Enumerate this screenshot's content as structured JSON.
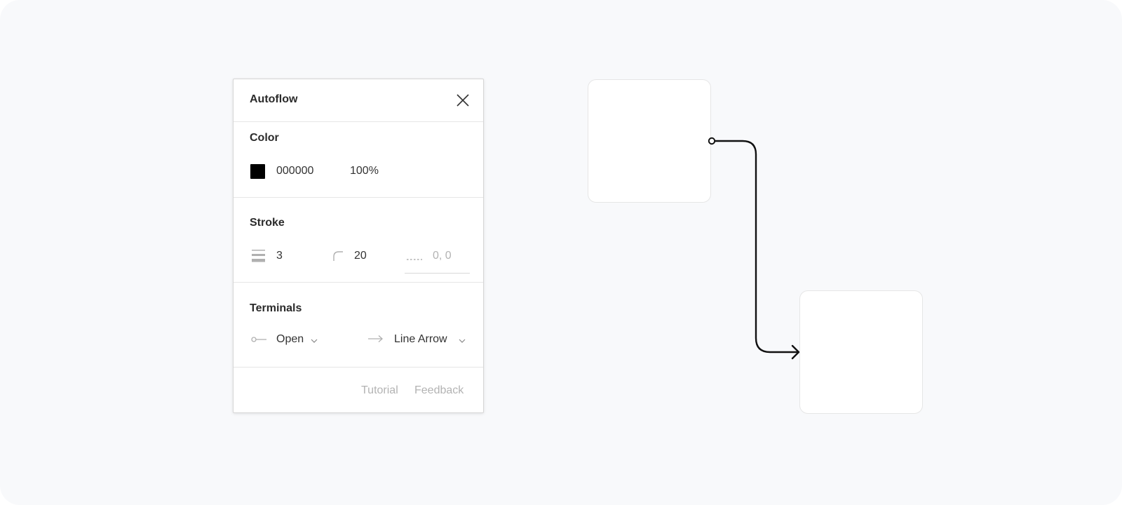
{
  "panel": {
    "title": "Autoflow",
    "color": {
      "heading": "Color",
      "hex": "000000",
      "swatch": "#000000",
      "opacity": "100%"
    },
    "stroke": {
      "heading": "Stroke",
      "weight": "3",
      "corner_radius": "20",
      "dash": "0, 0"
    },
    "terminals": {
      "heading": "Terminals",
      "start": "Open",
      "end": "Line Arrow"
    },
    "footer": {
      "tutorial": "Tutorial",
      "feedback": "Feedback"
    }
  },
  "icons": {
    "close": "close-icon",
    "stroke_weight": "stroke-weight-icon",
    "corner_radius": "corner-radius-icon",
    "dash": "dash-pattern-icon",
    "start_terminal": "open-terminal-icon",
    "end_terminal": "arrow-terminal-icon",
    "dropdown": "chevron-down-icon"
  },
  "colors": {
    "canvas_bg": "#f8f9fb",
    "connector": "#111111"
  }
}
